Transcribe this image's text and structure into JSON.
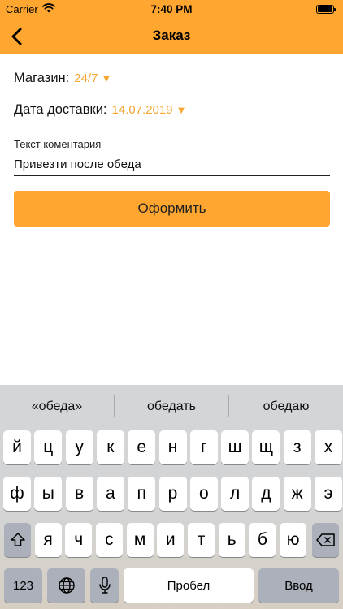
{
  "status_bar": {
    "carrier": "Carrier",
    "time": "7:40 PM",
    "wifi_icon": "wifi-icon",
    "battery_icon": "battery-icon"
  },
  "nav": {
    "title": "Заказ",
    "back_icon": "chevron-left-icon"
  },
  "form": {
    "store_label": "Магазин:",
    "store_value": "24/7",
    "date_label": "Дата доставки:",
    "date_value": "14.07.2019",
    "dropdown_icon": "triangle-down-icon",
    "comment_label": "Текст коментария",
    "comment_value": "Привезти после обеда",
    "submit_label": "Оформить"
  },
  "keyboard": {
    "suggestions": [
      "«обеда»",
      "обедать",
      "обедаю"
    ],
    "row1": [
      "й",
      "ц",
      "у",
      "к",
      "е",
      "н",
      "г",
      "ш",
      "щ",
      "з",
      "х"
    ],
    "row2": [
      "ф",
      "ы",
      "в",
      "а",
      "п",
      "р",
      "о",
      "л",
      "д",
      "ж",
      "э"
    ],
    "row3": [
      "я",
      "ч",
      "с",
      "м",
      "и",
      "т",
      "ь",
      "б",
      "ю"
    ],
    "numbers_label": "123",
    "space_label": "Пробел",
    "return_label": "Ввод",
    "shift_icon": "shift-icon",
    "delete_icon": "backspace-icon",
    "globe_icon": "globe-icon",
    "mic_icon": "microphone-icon"
  },
  "colors": {
    "accent": "#ffa630",
    "value_text": "#f6a733",
    "keyboard_bg": "#d3d5d9",
    "key_dark": "#abb0ba"
  }
}
